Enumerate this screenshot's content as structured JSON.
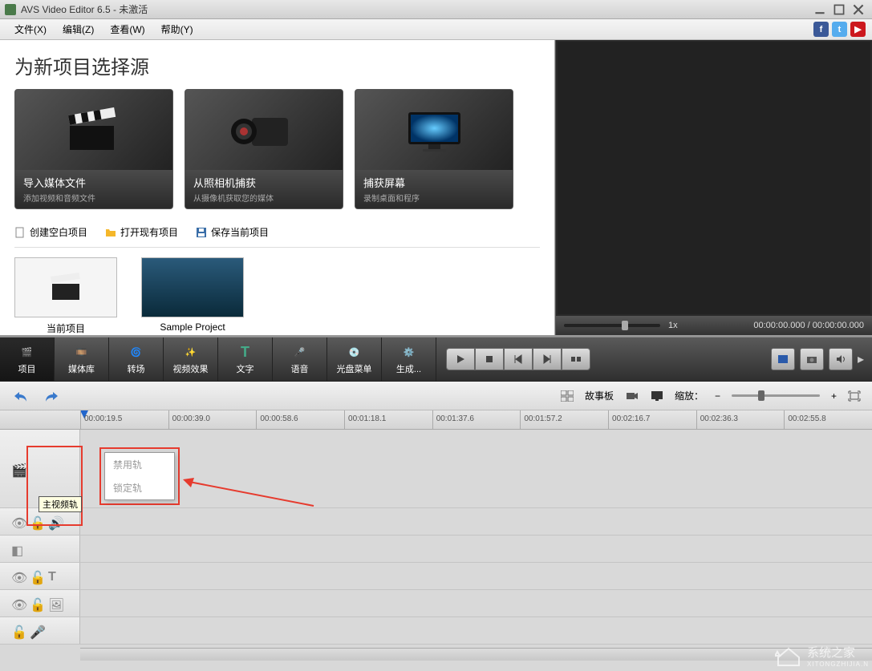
{
  "title": "AVS Video Editor 6.5 - 未激活",
  "menu": {
    "file": "文件(X)",
    "edit": "编辑(Z)",
    "view": "查看(W)",
    "help": "帮助(Y)"
  },
  "source": {
    "heading": "为新项目选择源",
    "cards": [
      {
        "title": "导入媒体文件",
        "sub": "添加视频和音频文件"
      },
      {
        "title": "从照相机捕获",
        "sub": "从摄像机获取您的媒体"
      },
      {
        "title": "捕获屏幕",
        "sub": "录制桌面和程序"
      }
    ],
    "projectbar": {
      "blank": "创建空白项目",
      "open": "打开现有项目",
      "save": "保存当前项目"
    },
    "thumbs": {
      "current": "当前项目",
      "sample": "Sample Project"
    }
  },
  "preview": {
    "speed": "1x",
    "time": "00:00:00.000 / 00:00:00.000"
  },
  "tabs": {
    "project": "项目",
    "media": "媒体库",
    "trans": "转场",
    "vfx": "视频效果",
    "text": "文字",
    "voice": "语音",
    "disc": "光盘菜单",
    "produce": "生成..."
  },
  "tltoolbar": {
    "storyboard": "故事板",
    "zoom": "缩放："
  },
  "ruler": [
    "00:00:19.5",
    "00:00:39.0",
    "00:00:58.6",
    "00:01:18.1",
    "00:01:37.6",
    "00:01:57.2",
    "00:02:16.7",
    "00:02:36.3",
    "00:02:55.8"
  ],
  "ctx": {
    "disable": "禁用轨",
    "lock": "锁定轨"
  },
  "tooltip": "主视频轨",
  "watermark": "系统之家",
  "watermark_sub": "XITONGZHIJIA.N"
}
